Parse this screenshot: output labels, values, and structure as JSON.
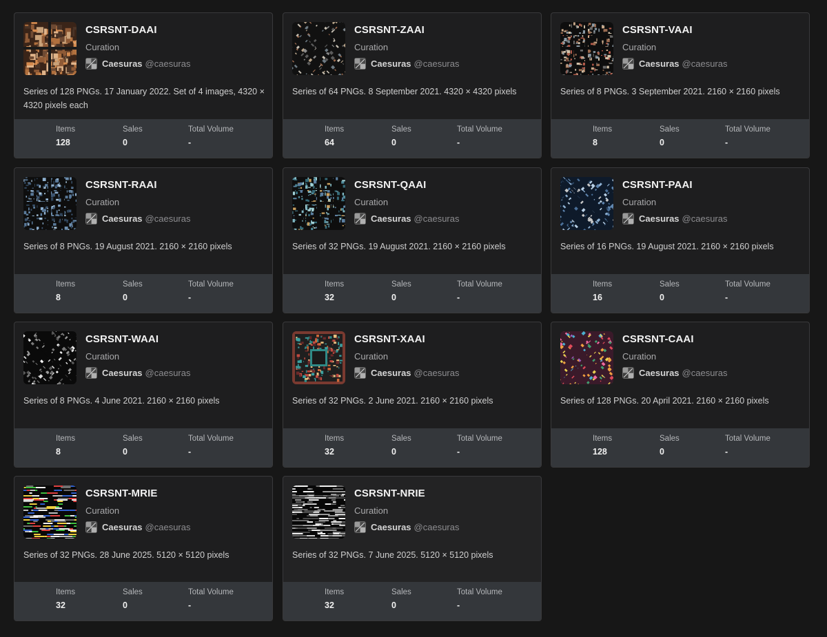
{
  "collections": [
    {
      "title": "CSRSNT-DAAI",
      "kind": "Curation",
      "artist": "Caesuras",
      "handle": "@caesuras",
      "description": "Series of 128 PNGs. 17 January 2022. Set of 4 images, 4320 × 4320 pixels each",
      "items_label": "Items",
      "items": "128",
      "sales_label": "Sales",
      "sales": "0",
      "volume_label": "Total Volume",
      "volume": "-",
      "thumb": "orange-collage"
    },
    {
      "title": "CSRSNT-ZAAI",
      "kind": "Curation",
      "artist": "Caesuras",
      "handle": "@caesuras",
      "description": "Series of 64 PNGs. 8 September 2021. 4320 × 4320 pixels",
      "items_label": "Items",
      "items": "64",
      "sales_label": "Sales",
      "sales": "0",
      "volume_label": "Total Volume",
      "volume": "-",
      "thumb": "diagonal-grid"
    },
    {
      "title": "CSRSNT-VAAI",
      "kind": "Curation",
      "artist": "Caesuras",
      "handle": "@caesuras",
      "description": "Series of 8 PNGs. 3 September 2021. 2160 × 2160 pixels",
      "items_label": "Items",
      "items": "8",
      "sales_label": "Sales",
      "sales": "0",
      "volume_label": "Total Volume",
      "volume": "-",
      "thumb": "quad-grid-warm"
    },
    {
      "title": "CSRSNT-RAAI",
      "kind": "Curation",
      "artist": "Caesuras",
      "handle": "@caesuras",
      "description": "Series of 8 PNGs. 19 August 2021. 2160 × 2160 pixels",
      "items_label": "Items",
      "items": "8",
      "sales_label": "Sales",
      "sales": "0",
      "volume_label": "Total Volume",
      "volume": "-",
      "thumb": "quad-grid-blue"
    },
    {
      "title": "CSRSNT-QAAI",
      "kind": "Curation",
      "artist": "Caesuras",
      "handle": "@caesuras",
      "description": "Series of 32 PNGs. 19 August 2021. 2160 × 2160 pixels",
      "items_label": "Items",
      "items": "32",
      "sales_label": "Sales",
      "sales": "0",
      "volume_label": "Total Volume",
      "volume": "-",
      "thumb": "quad-grid-teal"
    },
    {
      "title": "CSRSNT-PAAI",
      "kind": "Curation",
      "artist": "Caesuras",
      "handle": "@caesuras",
      "description": "Series of 16 PNGs. 19 August 2021. 2160 × 2160 pixels",
      "items_label": "Items",
      "items": "16",
      "sales_label": "Sales",
      "sales": "0",
      "volume_label": "Total Volume",
      "volume": "-",
      "thumb": "diagonal-blue"
    },
    {
      "title": "CSRSNT-WAAI",
      "kind": "Curation",
      "artist": "Caesuras",
      "handle": "@caesuras",
      "description": "Series of 8 PNGs. 4 June 2021. 2160 × 2160 pixels",
      "items_label": "Items",
      "items": "8",
      "sales_label": "Sales",
      "sales": "0",
      "volume_label": "Total Volume",
      "volume": "-",
      "thumb": "diagonal-mono"
    },
    {
      "title": "CSRSNT-XAAI",
      "kind": "Curation",
      "artist": "Caesuras",
      "handle": "@caesuras",
      "description": "Series of 32 PNGs. 2 June 2021. 2160 × 2160 pixels",
      "items_label": "Items",
      "items": "32",
      "sales_label": "Sales",
      "sales": "0",
      "volume_label": "Total Volume",
      "volume": "-",
      "thumb": "circuit-teal"
    },
    {
      "title": "CSRSNT-CAAI",
      "kind": "Curation",
      "artist": "Caesuras",
      "handle": "@caesuras",
      "description": "Series of 128 PNGs. 20 April 2021. 2160 × 2160 pixels",
      "items_label": "Items",
      "items": "128",
      "sales_label": "Sales",
      "sales": "0",
      "volume_label": "Total Volume",
      "volume": "-",
      "thumb": "diagonal-rainbow"
    },
    {
      "title": "CSRSNT-MRIE",
      "kind": "Curation",
      "artist": "Caesuras",
      "handle": "@caesuras",
      "description": "Series of 32 PNGs. 28 June 2025. 5120 × 5120 pixels",
      "items_label": "Items",
      "items": "32",
      "sales_label": "Sales",
      "sales": "0",
      "volume_label": "Total Volume",
      "volume": "-",
      "thumb": "glitch-color"
    },
    {
      "title": "CSRSNT-NRIE",
      "kind": "Curation",
      "artist": "Caesuras",
      "handle": "@caesuras",
      "description": "Series of 32 PNGs. 7 June 2025. 5120 × 5120 pixels",
      "items_label": "Items",
      "items": "32",
      "sales_label": "Sales",
      "sales": "0",
      "volume_label": "Total Volume",
      "volume": "-",
      "thumb": "glitch-mono"
    }
  ]
}
